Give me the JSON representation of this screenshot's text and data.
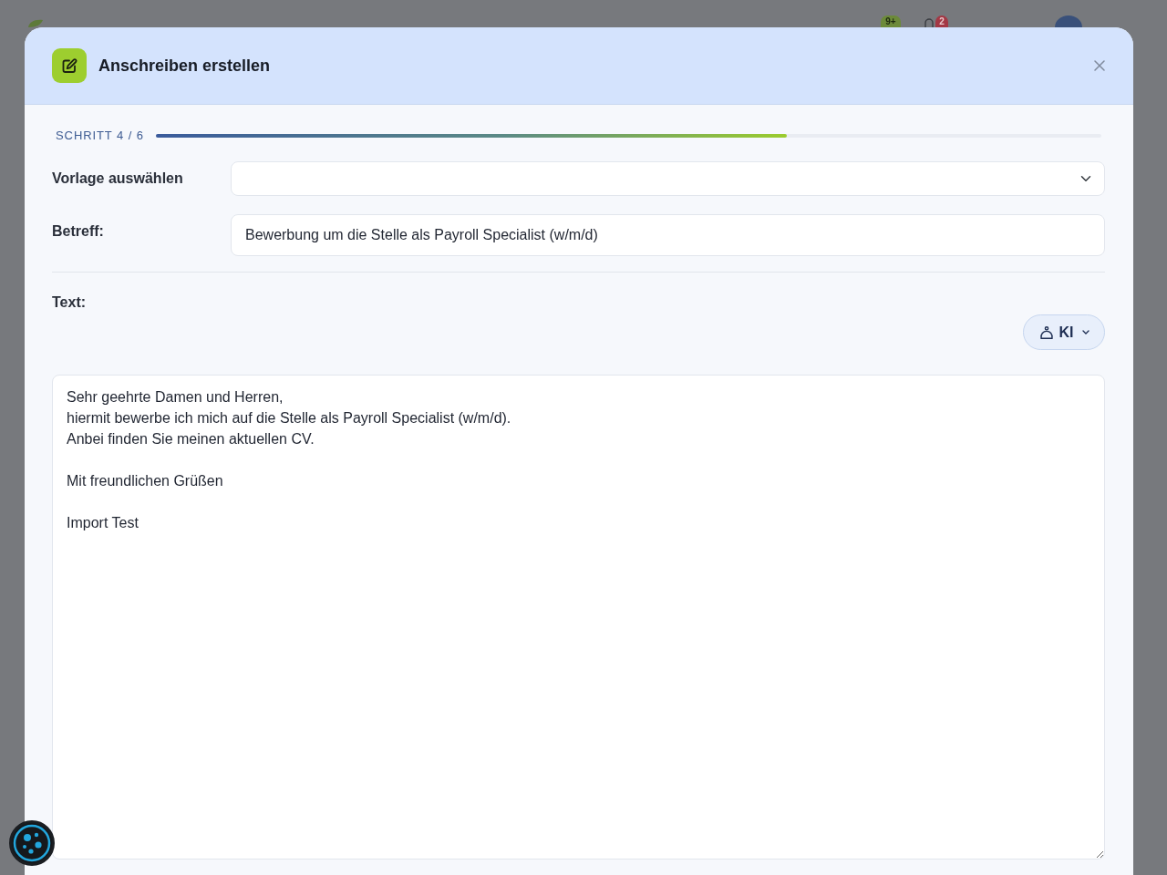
{
  "background": {
    "badges": [
      {
        "kind": "pill",
        "text": "9+",
        "color": "#6c8a3a"
      },
      {
        "kind": "bell",
        "text": "2",
        "color": "#a33845"
      }
    ]
  },
  "dialog": {
    "title": "Anschreiben erstellen",
    "progress": {
      "label": "SCHRITT 4 / 6",
      "level": 0.667
    },
    "fields": [
      {
        "kind": "select",
        "label": "Vorlage auswählen"
      },
      {
        "kind": "text",
        "label": "Betreff:",
        "value": "Bewerbung um die Stelle als Payroll Specialist (w/m/d)"
      }
    ],
    "text_section": {
      "label": "Text:",
      "ai_button": {
        "label": "KI"
      },
      "body": "Sehr geehrte Damen und Herren,\nhiermit bewerbe ich mich auf die Stelle als Payroll Specialist (w/m/d).\nAnbei finden Sie meinen aktuellen CV.\n\nMit freundlichen Grüßen\n\nImport Test"
    }
  }
}
